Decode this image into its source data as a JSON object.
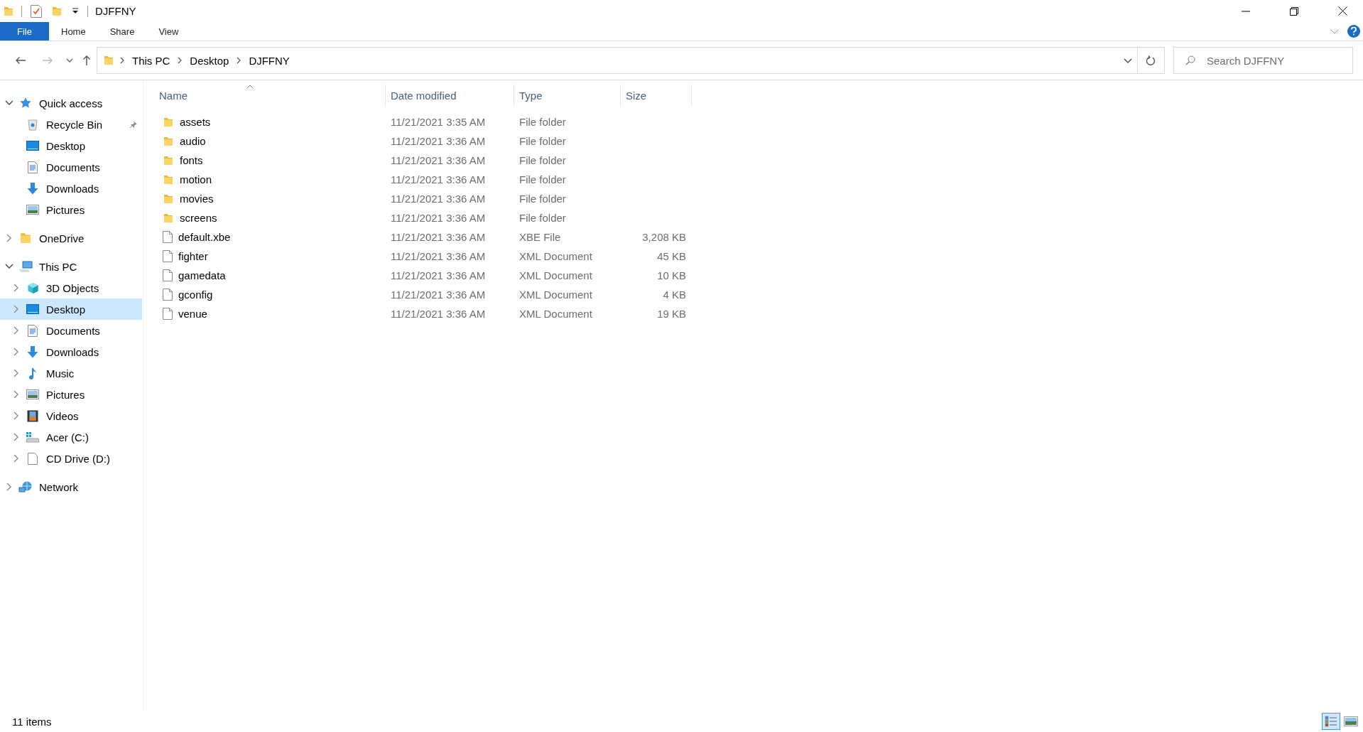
{
  "window": {
    "title": "DJFFNY"
  },
  "ribbon_tabs": [
    {
      "label": "File",
      "kind": "file",
      "selected": false
    },
    {
      "label": "Home",
      "kind": "tab",
      "selected": false
    },
    {
      "label": "Share",
      "kind": "tab",
      "selected": false
    },
    {
      "label": "View",
      "kind": "tab",
      "selected": false
    }
  ],
  "address_bar": {
    "path": [
      "This PC",
      "Desktop",
      "DJFFNY"
    ]
  },
  "search": {
    "placeholder": "Search DJFFNY"
  },
  "sidebar": {
    "items": [
      {
        "label": "Quick access",
        "kind": "star",
        "expanded": true,
        "selected": false,
        "children": [
          {
            "label": "Recycle Bin",
            "kind": "bin",
            "pinned": true,
            "selected": false
          },
          {
            "label": "Desktop",
            "kind": "desktop",
            "pinned": false,
            "selected": false
          },
          {
            "label": "Documents",
            "kind": "documents",
            "pinned": false,
            "selected": false
          },
          {
            "label": "Downloads",
            "kind": "downloads",
            "pinned": false,
            "selected": false
          },
          {
            "label": "Pictures",
            "kind": "pictures",
            "pinned": false,
            "selected": false
          }
        ]
      },
      {
        "label": "OneDrive",
        "kind": "folder",
        "expanded": false,
        "selected": false
      },
      {
        "label": "This PC",
        "kind": "pc",
        "expanded": true,
        "selected": false,
        "children": [
          {
            "label": "3D Objects",
            "kind": "cube",
            "expanded": false,
            "selected": false
          },
          {
            "label": "Desktop",
            "kind": "desktop",
            "expanded": false,
            "selected": true
          },
          {
            "label": "Documents",
            "kind": "documents",
            "expanded": false,
            "selected": false
          },
          {
            "label": "Downloads",
            "kind": "downloads",
            "expanded": false,
            "selected": false
          },
          {
            "label": "Music",
            "kind": "music",
            "expanded": false,
            "selected": false
          },
          {
            "label": "Pictures",
            "kind": "pictures",
            "expanded": false,
            "selected": false
          },
          {
            "label": "Videos",
            "kind": "videos",
            "expanded": false,
            "selected": false
          },
          {
            "label": "Acer (C:)",
            "kind": "drive",
            "expanded": false,
            "selected": false
          },
          {
            "label": "CD Drive (D:)",
            "kind": "disc",
            "expanded": false,
            "selected": false
          }
        ]
      },
      {
        "label": "Network",
        "kind": "network",
        "expanded": false,
        "selected": false
      }
    ]
  },
  "table": {
    "columns": [
      {
        "label": "Name",
        "sorted": true
      },
      {
        "label": "Date modified",
        "sorted": false
      },
      {
        "label": "Type",
        "sorted": false
      },
      {
        "label": "Size",
        "sorted": false
      }
    ],
    "rows": [
      {
        "kind": "folder",
        "name": "assets",
        "date": "11/21/2021 3:35 AM",
        "type": "File folder"
      },
      {
        "kind": "folder",
        "name": "audio",
        "date": "11/21/2021 3:36 AM",
        "type": "File folder"
      },
      {
        "kind": "folder",
        "name": "fonts",
        "date": "11/21/2021 3:36 AM",
        "type": "File folder"
      },
      {
        "kind": "folder",
        "name": "motion",
        "date": "11/21/2021 3:36 AM",
        "type": "File folder"
      },
      {
        "kind": "folder",
        "name": "movies",
        "date": "11/21/2021 3:36 AM",
        "type": "File folder"
      },
      {
        "kind": "folder",
        "name": "screens",
        "date": "11/21/2021 3:36 AM",
        "type": "File folder"
      },
      {
        "kind": "file",
        "name": "default.xbe",
        "date": "11/21/2021 3:36 AM",
        "type": "XBE File",
        "size": "3,208 KB"
      },
      {
        "kind": "file",
        "name": "fighter",
        "date": "11/21/2021 3:36 AM",
        "type": "XML Document",
        "size": "45 KB"
      },
      {
        "kind": "file",
        "name": "gamedata",
        "date": "11/21/2021 3:36 AM",
        "type": "XML Document",
        "size": "10 KB"
      },
      {
        "kind": "file",
        "name": "gconfig",
        "date": "11/21/2021 3:36 AM",
        "type": "XML Document",
        "size": "4 KB"
      },
      {
        "kind": "file",
        "name": "venue",
        "date": "11/21/2021 3:36 AM",
        "type": "XML Document",
        "size": "19 KB"
      }
    ]
  },
  "status_bar": {
    "text": "11 items"
  },
  "view_buttons": [
    {
      "kind": "details",
      "selected": true
    },
    {
      "kind": "thumbnails",
      "selected": false
    }
  ]
}
